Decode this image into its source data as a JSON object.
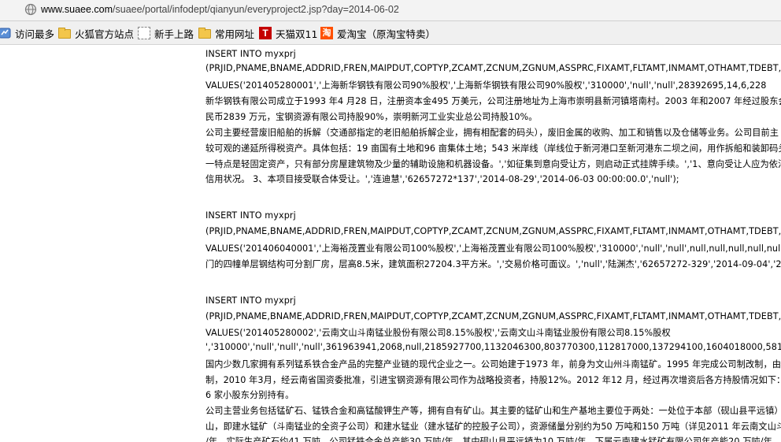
{
  "browser": {
    "url_host": "www.suaee.com",
    "url_path": "/suaee/portal/infodept/qianyun/everyproject2.jsp?day=2014-06-02"
  },
  "bookmarks": [
    {
      "label": "访问最多",
      "icon": "most-visited-icon"
    },
    {
      "label": "火狐官方站点",
      "icon": "folder-icon"
    },
    {
      "label": "新手上路",
      "icon": "page-icon"
    },
    {
      "label": "常用网址",
      "icon": "folder-icon"
    },
    {
      "label": "天猫双11",
      "icon": "tmall-icon",
      "glyph": "T"
    },
    {
      "label": "爱淘宝（原淘宝特卖）",
      "icon": "taobao-icon",
      "glyph": "淘"
    }
  ],
  "content": {
    "lines": [
      "INSERT INTO myxprj",
      "(PRJID,PNAME,BNAME,ADDRID,FREN,MAIPDUT,COPTYP,ZCAMT,ZCNUM,ZGNUM,ASSPRC,FIXAMT,FLTAMT,INMAMT,OTHAMT,TDEBT,",
      "VALUES('201405280001','上海新华钢铁有限公司90%股权','上海新华钢铁有限公司90%股权','310000','null','null',28392695,14,6,228",
      "新华钢铁有限公司成立于1993 年4 月28 日，注册资本金495 万美元，公司注册地址为上海市崇明县新河镇塔南村。2003 年和2007 年经过股东会决",
      "民币2839 万元，宝钢资源有限公司持股90%，崇明新河工业实业总公司持股10%。",
      "    公司主要经营废旧船舶的拆解（交通部指定的老旧船舶拆解企业，拥有相配套的码头），废旧金属的收购、加工和销售以及仓储等业务。公司目前主",
      "较可观的递延所得税资产。具体包括：19 亩国有土地和96 亩集体土地；543 米岸线（岸线位于新河港口至新河港东二坝之间，用作拆船和装卸码头。",
      "一特点是轻固定资产，只有部分房屋建筑物及少量的辅助设施和机器设备。','如征集到意向受让方，则启动正式挂牌手续。','1、意向受让人应为依法设",
      "信用状况。 3、本项目接受联合体受让。','连迪慧','62657272*137','2014-08-29','2014-06-03 00:00:00.0','null');",
      "INSERT INTO myxprj",
      "(PRJID,PNAME,BNAME,ADDRID,FREN,MAIPDUT,COPTYP,ZCAMT,ZCNUM,ZGNUM,ASSPRC,FIXAMT,FLTAMT,INMAMT,OTHAMT,TDEBT,",
      "VALUES('201406040001','上海裕茂置业有限公司100%股权','上海裕茂置业有限公司100%股权','310000','null','null',null,null,null,null,nul",
      "门的四幢单层钢结构可分割厂房，层高8.5米，建筑面积27204.3平方米。','交易价格可面议。','null','陆渊杰','62657272-329','2014-09-04','201",
      "INSERT INTO myxprj",
      "(PRJID,PNAME,BNAME,ADDRID,FREN,MAIPDUT,COPTYP,ZCAMT,ZCNUM,ZGNUM,ASSPRC,FIXAMT,FLTAMT,INMAMT,OTHAMT,TDEBT,",
      "VALUES('201405280002','云南文山斗南锰业股份有限公司8.15%股权','云南文山斗南锰业股份有限公司8.15%股权",
      "','310000','null','null','null',361963941,2068,null,2185927700,1132046300,803770300,112817000,137294100,1604018000,58190",
      "国内少数几家拥有系列锰系铁合金产品的完整产业链的现代企业之一。公司始建于1973 年，前身为文山州斗南锰矿。1995 年完成公司制改制，由云南",
      "制，2010 年3月，经云南省国资委批准，引进宝钢资源有限公司作为战略投资者，持股12%。2012 年12 月，经过再次增资后各方持股情况如下：云",
      "6 家小股东分别持有。",
      "    公司主营业务包括锰矿石、锰铁合金和高锰酸钾生产等，拥有自有矿山。其主要的锰矿山和生产基地主要位于两处：一处位于本部（砚山县平远镇）",
      "山，即建水锰矿（斗南锰业的全资子公司）和建水锰业（建水锰矿的控股子公司），资源储量分别约为50 万吨和150 万吨（详见2011 年云南文山斗南",
      "/年，实际生产矿石约41 万吨。公司锰铁合金总产能30 万吨/年，其中砚山县平远镇为10 万吨/年，下属云南建水锰矿有限公司年产能20 万吨/年"
    ]
  }
}
